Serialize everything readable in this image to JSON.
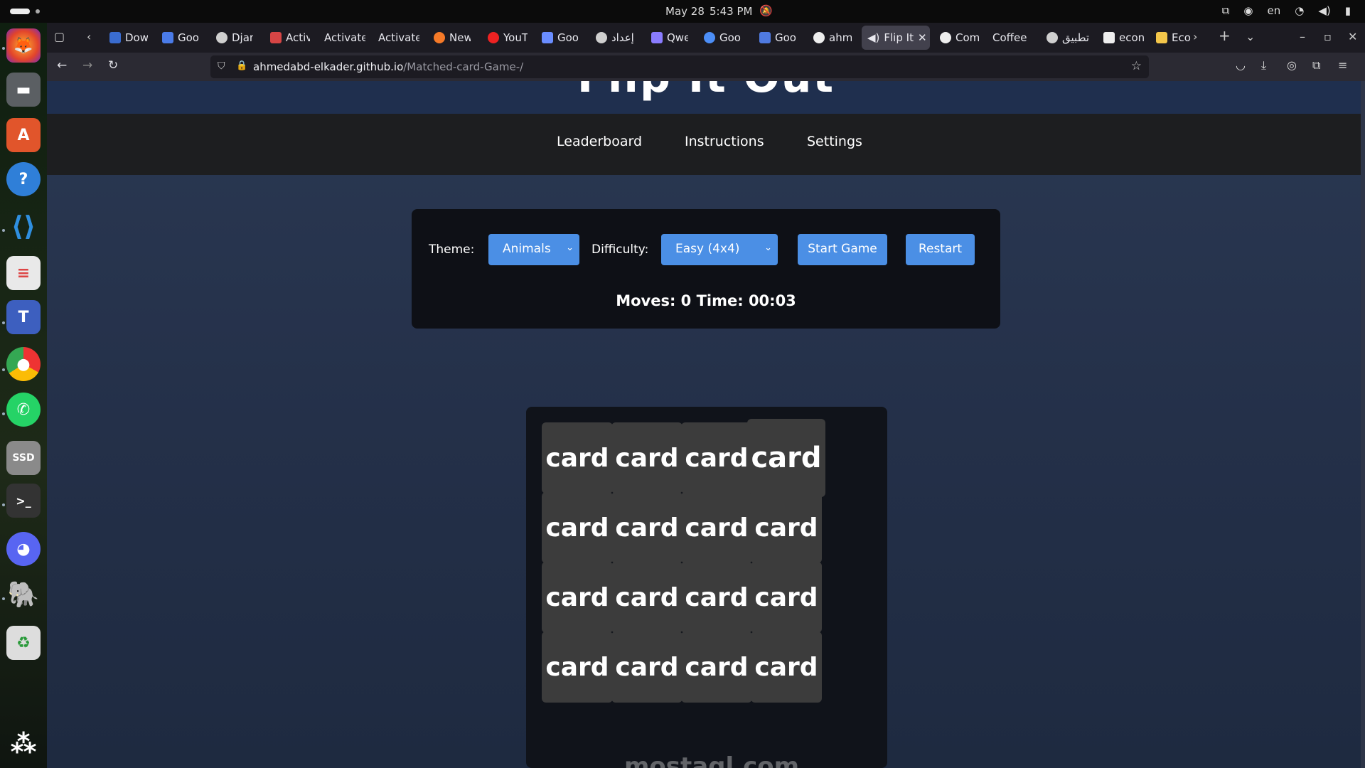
{
  "system": {
    "date": "May 28",
    "time": "5:43 PM",
    "lang": "en"
  },
  "tabs": [
    {
      "label": "Dow",
      "color": "#3a6ccf"
    },
    {
      "label": "Goo",
      "color": "#4a7be8"
    },
    {
      "label": "Djan",
      "color": "#cfcfcf"
    },
    {
      "label": "Activ",
      "color": "#d64545"
    },
    {
      "label": "Activate",
      "color": ""
    },
    {
      "label": "Activate",
      "color": ""
    },
    {
      "label": "New",
      "color": "#f57a28"
    },
    {
      "label": "YouT",
      "color": "#e22"
    },
    {
      "label": "Goo",
      "color": "#6a8dff"
    },
    {
      "label": "إعداد",
      "color": "#cfcfcf"
    },
    {
      "label": "Qwe",
      "color": "#8a7cff"
    },
    {
      "label": "Goo",
      "color": "#4c8ef7"
    },
    {
      "label": "Goo",
      "color": "#4f7ae0"
    },
    {
      "label": "ahm",
      "color": "#eee"
    },
    {
      "label": "Flip It",
      "color": "#ddd"
    },
    {
      "label": "Com",
      "color": "#eee"
    },
    {
      "label": "Coffee",
      "color": ""
    },
    {
      "label": "تطبيق",
      "color": "#cfcfcf"
    },
    {
      "label": "econ",
      "color": "#eee"
    },
    {
      "label": "Eco",
      "color": "#f3c64a"
    }
  ],
  "url": {
    "host": "ahmedabd-elkader.github.io",
    "path": "/Matched-card-Game-/"
  },
  "site": {
    "title": "Flip It Out",
    "nav": [
      "Leaderboard",
      "Instructions",
      "Settings"
    ]
  },
  "controls": {
    "theme_label": "Theme:",
    "theme_value": "Animals",
    "difficulty_label": "Difficulty:",
    "difficulty_value": "Easy (4x4)",
    "start_label": "Start Game",
    "restart_label": "Restart",
    "stats": "Moves: 0 Time: 00:03"
  },
  "board": {
    "card_text": "card",
    "rows": 4,
    "cols": 4
  },
  "watermark": "mostaql.com",
  "colors": {
    "accent": "#4b8fe5",
    "panel": "#0e1016",
    "card": "#3c3c3c"
  }
}
